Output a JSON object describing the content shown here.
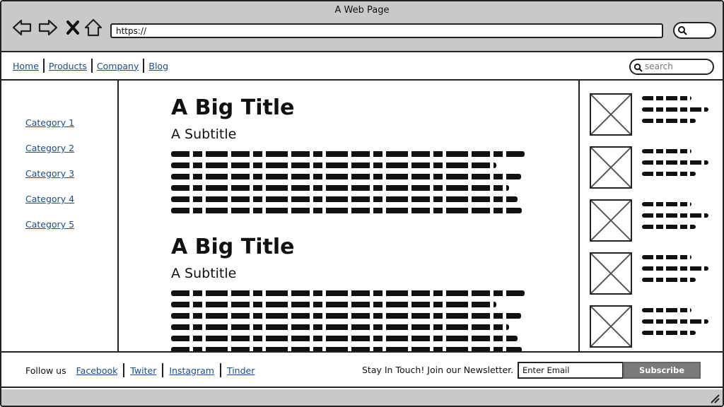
{
  "window": {
    "title": "A Web Page"
  },
  "toolbar": {
    "back_icon": "back-arrow-icon",
    "forward_icon": "forward-arrow-icon",
    "stop_icon": "close-icon",
    "home_icon": "home-icon",
    "url_value": "https://",
    "search_icon": "search-icon"
  },
  "nav": {
    "links": [
      "Home",
      "Products",
      "Company",
      "Blog"
    ],
    "search_placeholder": "search"
  },
  "sidebar": {
    "categories": [
      "Category 1",
      "Category 2",
      "Category 3",
      "Category 4",
      "Category 5"
    ]
  },
  "articles": [
    {
      "title": "A Big Title",
      "subtitle": "A Subtitle"
    },
    {
      "title": "A Big Title",
      "subtitle": "A Subtitle"
    }
  ],
  "footer": {
    "follow_label": "Follow us",
    "social_links": [
      "Facebook",
      "Twiter",
      "Instagram",
      "Tinder"
    ],
    "newsletter_label": "Stay In Touch! Join our Newsletter.",
    "email_value": "Enter Email",
    "subscribe_label": "Subscribe"
  },
  "colors": {
    "chrome": "#c9c9c9",
    "link": "#1a4f85",
    "button": "#7a7a7a"
  }
}
